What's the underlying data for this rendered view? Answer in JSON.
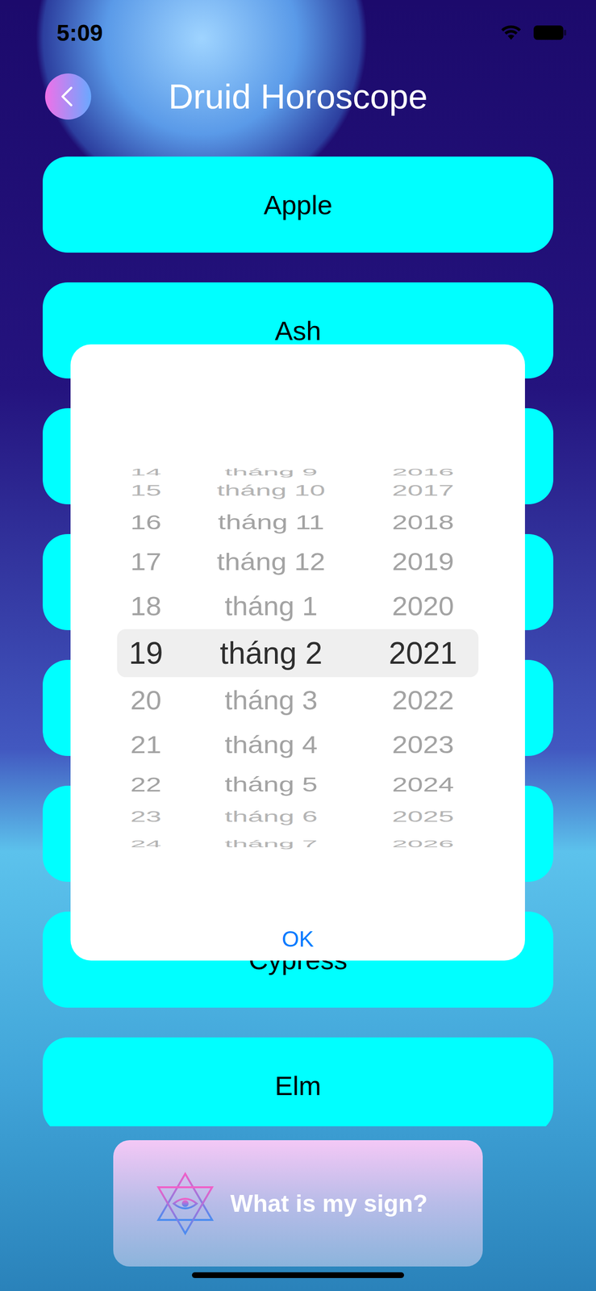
{
  "status_bar": {
    "time": "5:09"
  },
  "header": {
    "title": "Druid Horoscope"
  },
  "signs": [
    {
      "label": "Apple"
    },
    {
      "label": "Ash"
    },
    {
      "label": ""
    },
    {
      "label": ""
    },
    {
      "label": ""
    },
    {
      "label": ""
    },
    {
      "label": "Cypress"
    },
    {
      "label": "Elm"
    }
  ],
  "date_picker": {
    "rows": [
      {
        "day": "14",
        "month": "tháng 9",
        "year": "2016",
        "selected": false
      },
      {
        "day": "15",
        "month": "tháng 10",
        "year": "2017",
        "selected": false
      },
      {
        "day": "16",
        "month": "tháng 11",
        "year": "2018",
        "selected": false
      },
      {
        "day": "17",
        "month": "tháng 12",
        "year": "2019",
        "selected": false
      },
      {
        "day": "18",
        "month": "tháng 1",
        "year": "2020",
        "selected": false
      },
      {
        "day": "19",
        "month": "tháng 2",
        "year": "2021",
        "selected": true
      },
      {
        "day": "20",
        "month": "tháng 3",
        "year": "2022",
        "selected": false
      },
      {
        "day": "21",
        "month": "tháng 4",
        "year": "2023",
        "selected": false
      },
      {
        "day": "22",
        "month": "tháng 5",
        "year": "2024",
        "selected": false
      },
      {
        "day": "23",
        "month": "tháng 6",
        "year": "2025",
        "selected": false
      },
      {
        "day": "24",
        "month": "tháng 7",
        "year": "2026",
        "selected": false
      }
    ],
    "confirm": "OK"
  },
  "action_button": {
    "label": "What is my sign?"
  }
}
